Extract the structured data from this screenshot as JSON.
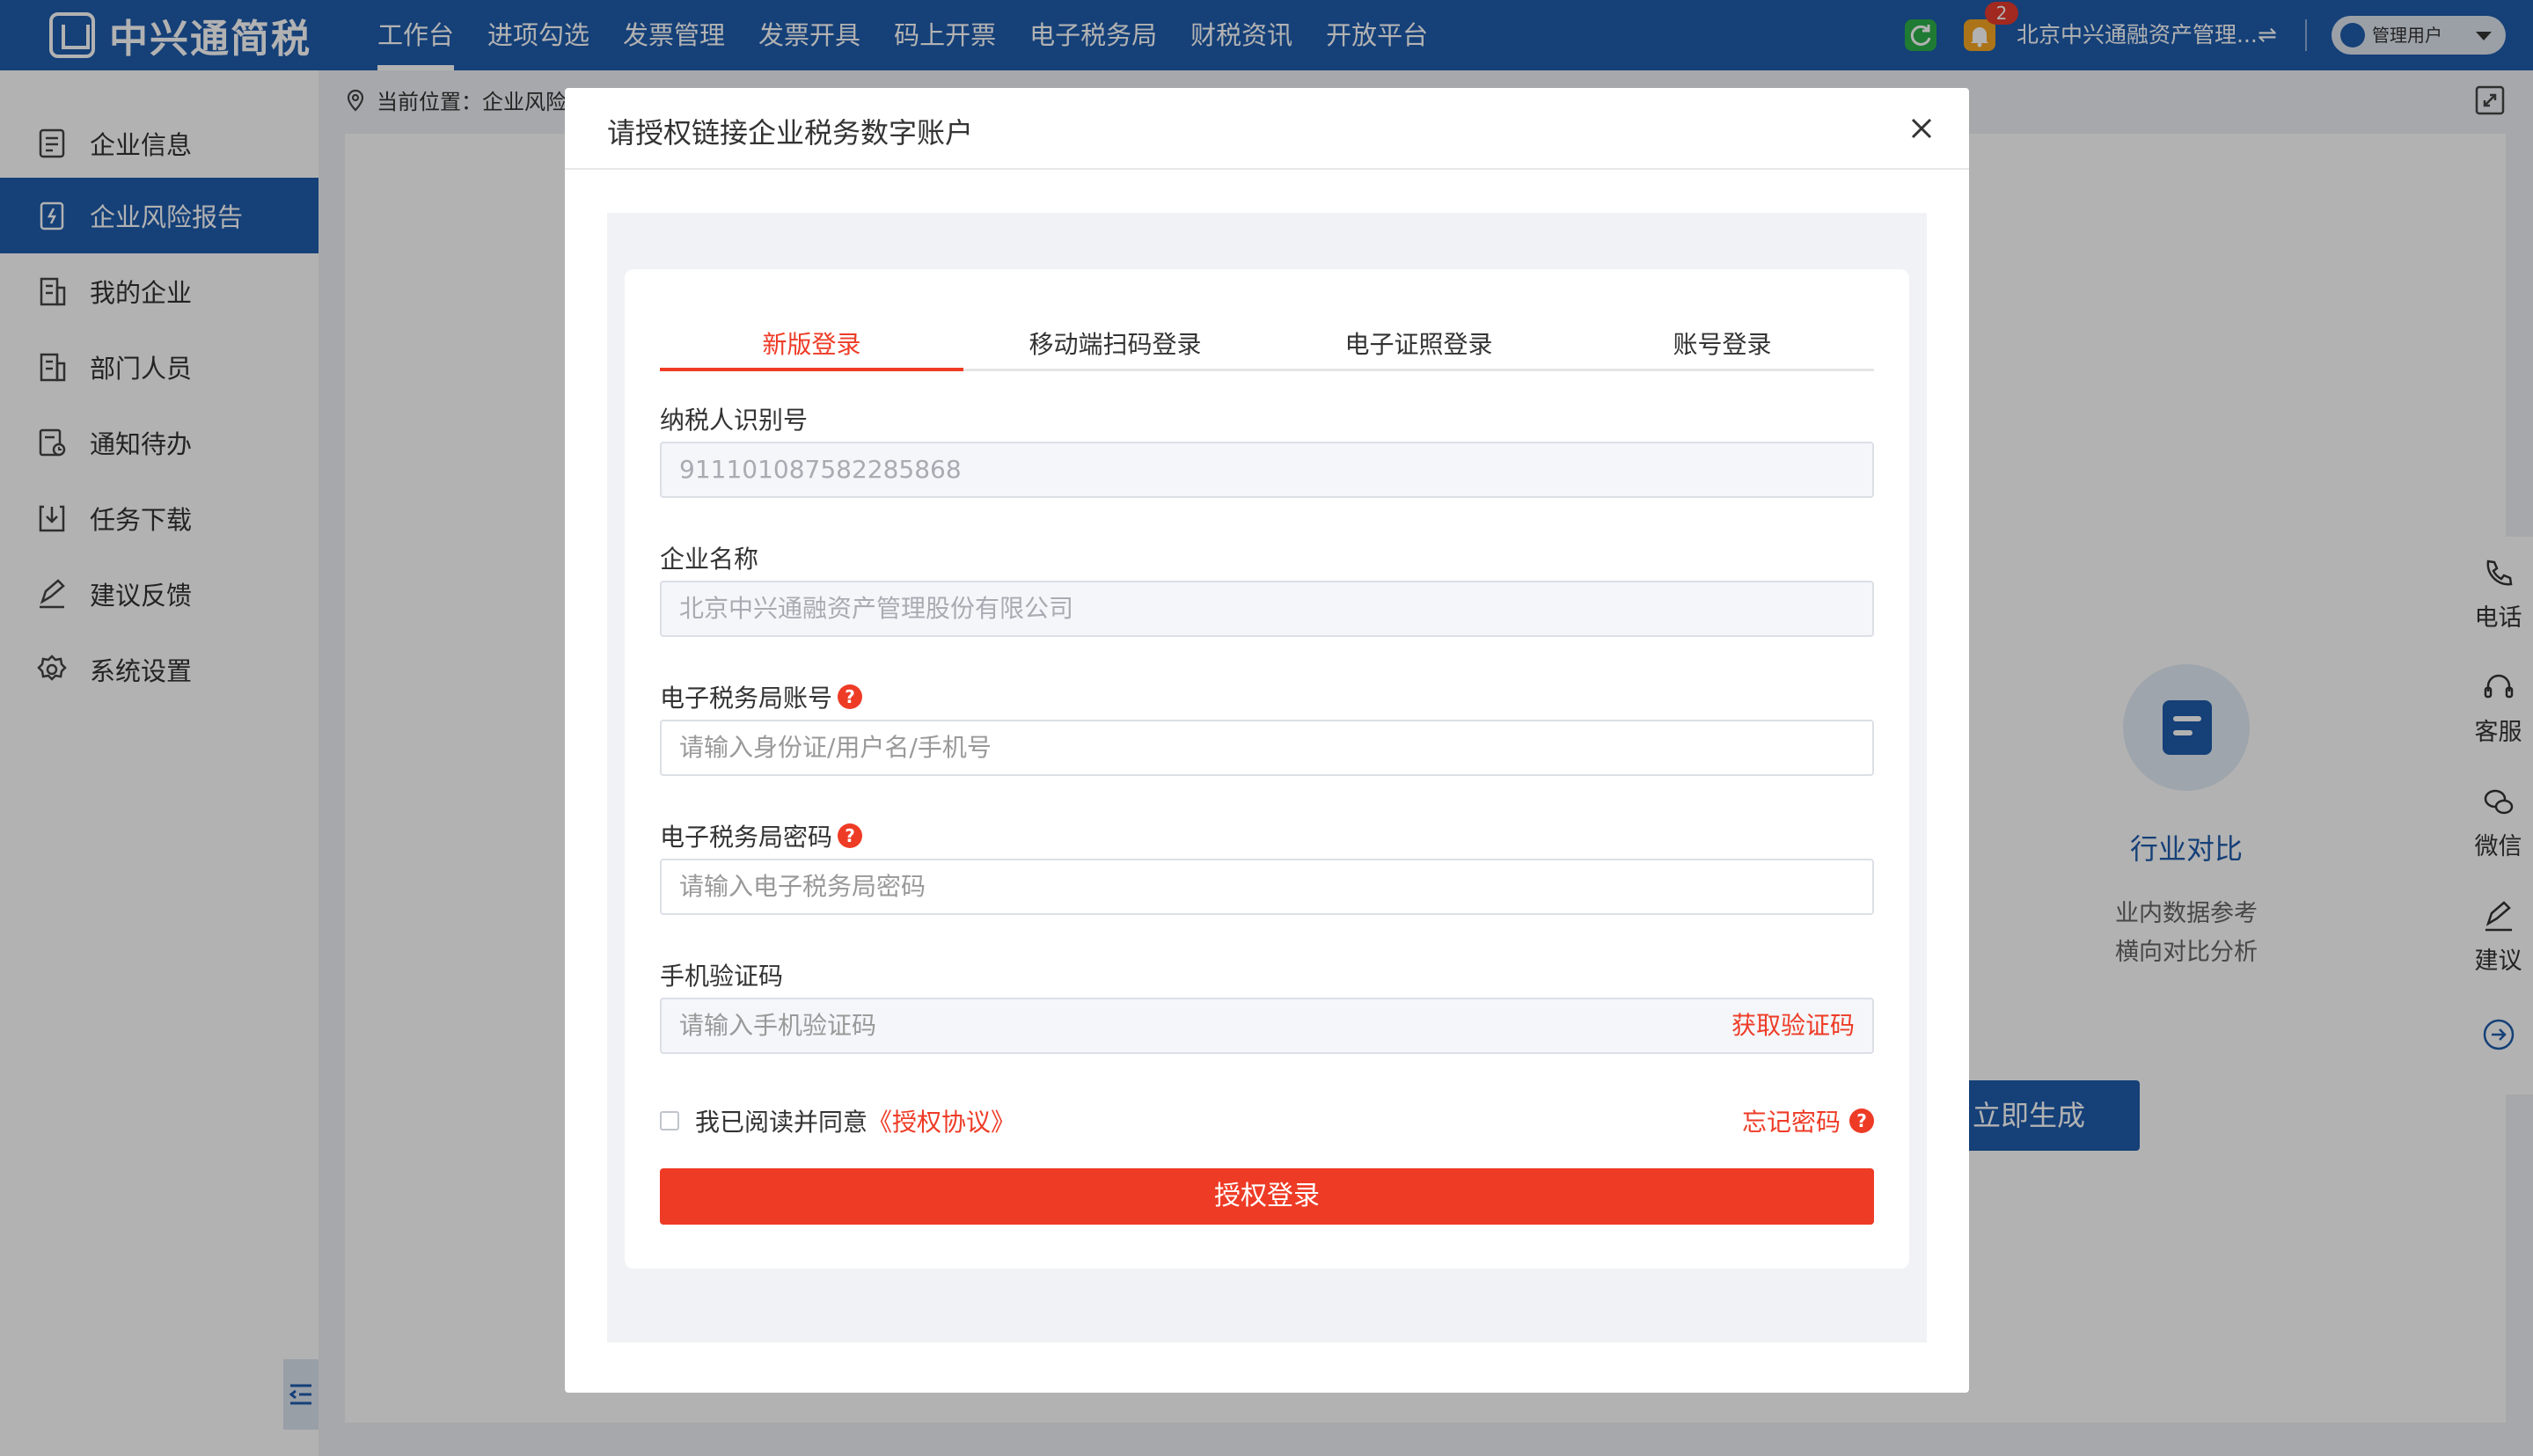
{
  "app": {
    "logo_text": "中兴通简税"
  },
  "nav": {
    "items": [
      "工作台",
      "进项勾选",
      "发票管理",
      "发票开具",
      "码上开票",
      "电子税务局",
      "财税资讯",
      "开放平台"
    ]
  },
  "header": {
    "badge_count": "2",
    "company": "北京中兴通融资产管理...",
    "switch_symbol": "⇌",
    "user": "管理用户"
  },
  "sidebar": {
    "items": [
      {
        "label": "企业信息",
        "icon": "info-list-icon"
      },
      {
        "label": "企业风险报告",
        "icon": "risk-report-icon"
      },
      {
        "label": "我的企业",
        "icon": "building-icon"
      },
      {
        "label": "部门人员",
        "icon": "department-icon"
      },
      {
        "label": "通知待办",
        "icon": "notice-icon"
      },
      {
        "label": "任务下载",
        "icon": "download-icon"
      },
      {
        "label": "建议反馈",
        "icon": "feedback-icon"
      },
      {
        "label": "系统设置",
        "icon": "settings-icon"
      }
    ]
  },
  "breadcrumb": {
    "text": "当前位置：企业风险"
  },
  "feature": {
    "title": "行业对比",
    "desc1": "业内数据参考",
    "desc2": "横向对比分析",
    "button": "立即生成"
  },
  "float_bar": {
    "items": [
      "电话",
      "客服",
      "微信",
      "建议"
    ]
  },
  "modal": {
    "title": "请授权链接企业税务数字账户",
    "tabs": [
      "新版登录",
      "移动端扫码登录",
      "电子证照登录",
      "账号登录"
    ],
    "fields": {
      "tax_id": {
        "label": "纳税人识别号",
        "value": "911101087582285868"
      },
      "company": {
        "label": "企业名称",
        "value": "北京中兴通融资产管理股份有限公司"
      },
      "account": {
        "label": "电子税务局账号",
        "placeholder": "请输入身份证/用户名/手机号"
      },
      "password": {
        "label": "电子税务局密码",
        "placeholder": "请输入电子税务局密码"
      },
      "sms": {
        "label": "手机验证码",
        "placeholder": "请输入手机验证码",
        "button": "获取验证码"
      }
    },
    "agree_text": "我已阅读并同意",
    "agree_link": "《授权协议》",
    "forgot": "忘记密码",
    "help_mark": "?",
    "submit": "授权登录"
  }
}
